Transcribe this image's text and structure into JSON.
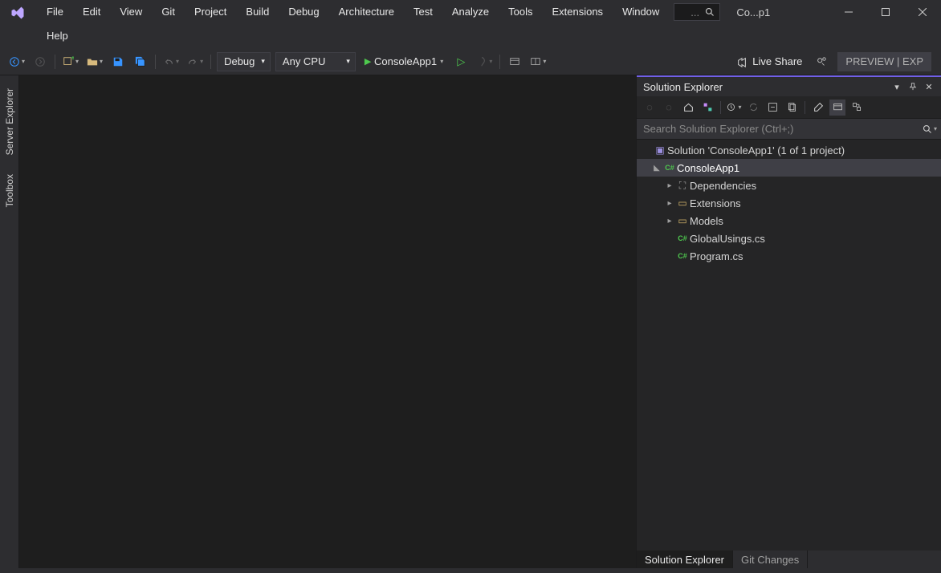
{
  "menubar": [
    "File",
    "Edit",
    "View",
    "Git",
    "Project",
    "Build",
    "Debug",
    "Architecture",
    "Test",
    "Analyze",
    "Tools",
    "Extensions",
    "Window",
    "Help"
  ],
  "title": "Co...p1",
  "toolbar": {
    "config": "Debug",
    "platform": "Any CPU",
    "start_target": "ConsoleApp1",
    "liveshare": "Live Share",
    "preview": "PREVIEW | EXP"
  },
  "left_rail": [
    "Server Explorer",
    "Toolbox"
  ],
  "solution_explorer": {
    "title": "Solution Explorer",
    "search_placeholder": "Search Solution Explorer (Ctrl+;)",
    "nodes": {
      "solution": "Solution 'ConsoleApp1' (1 of 1 project)",
      "project": "ConsoleApp1",
      "dependencies": "Dependencies",
      "extensions": "Extensions",
      "models": "Models",
      "globalusings": "GlobalUsings.cs",
      "program": "Program.cs"
    },
    "tabs": {
      "solution": "Solution Explorer",
      "git": "Git Changes"
    }
  }
}
